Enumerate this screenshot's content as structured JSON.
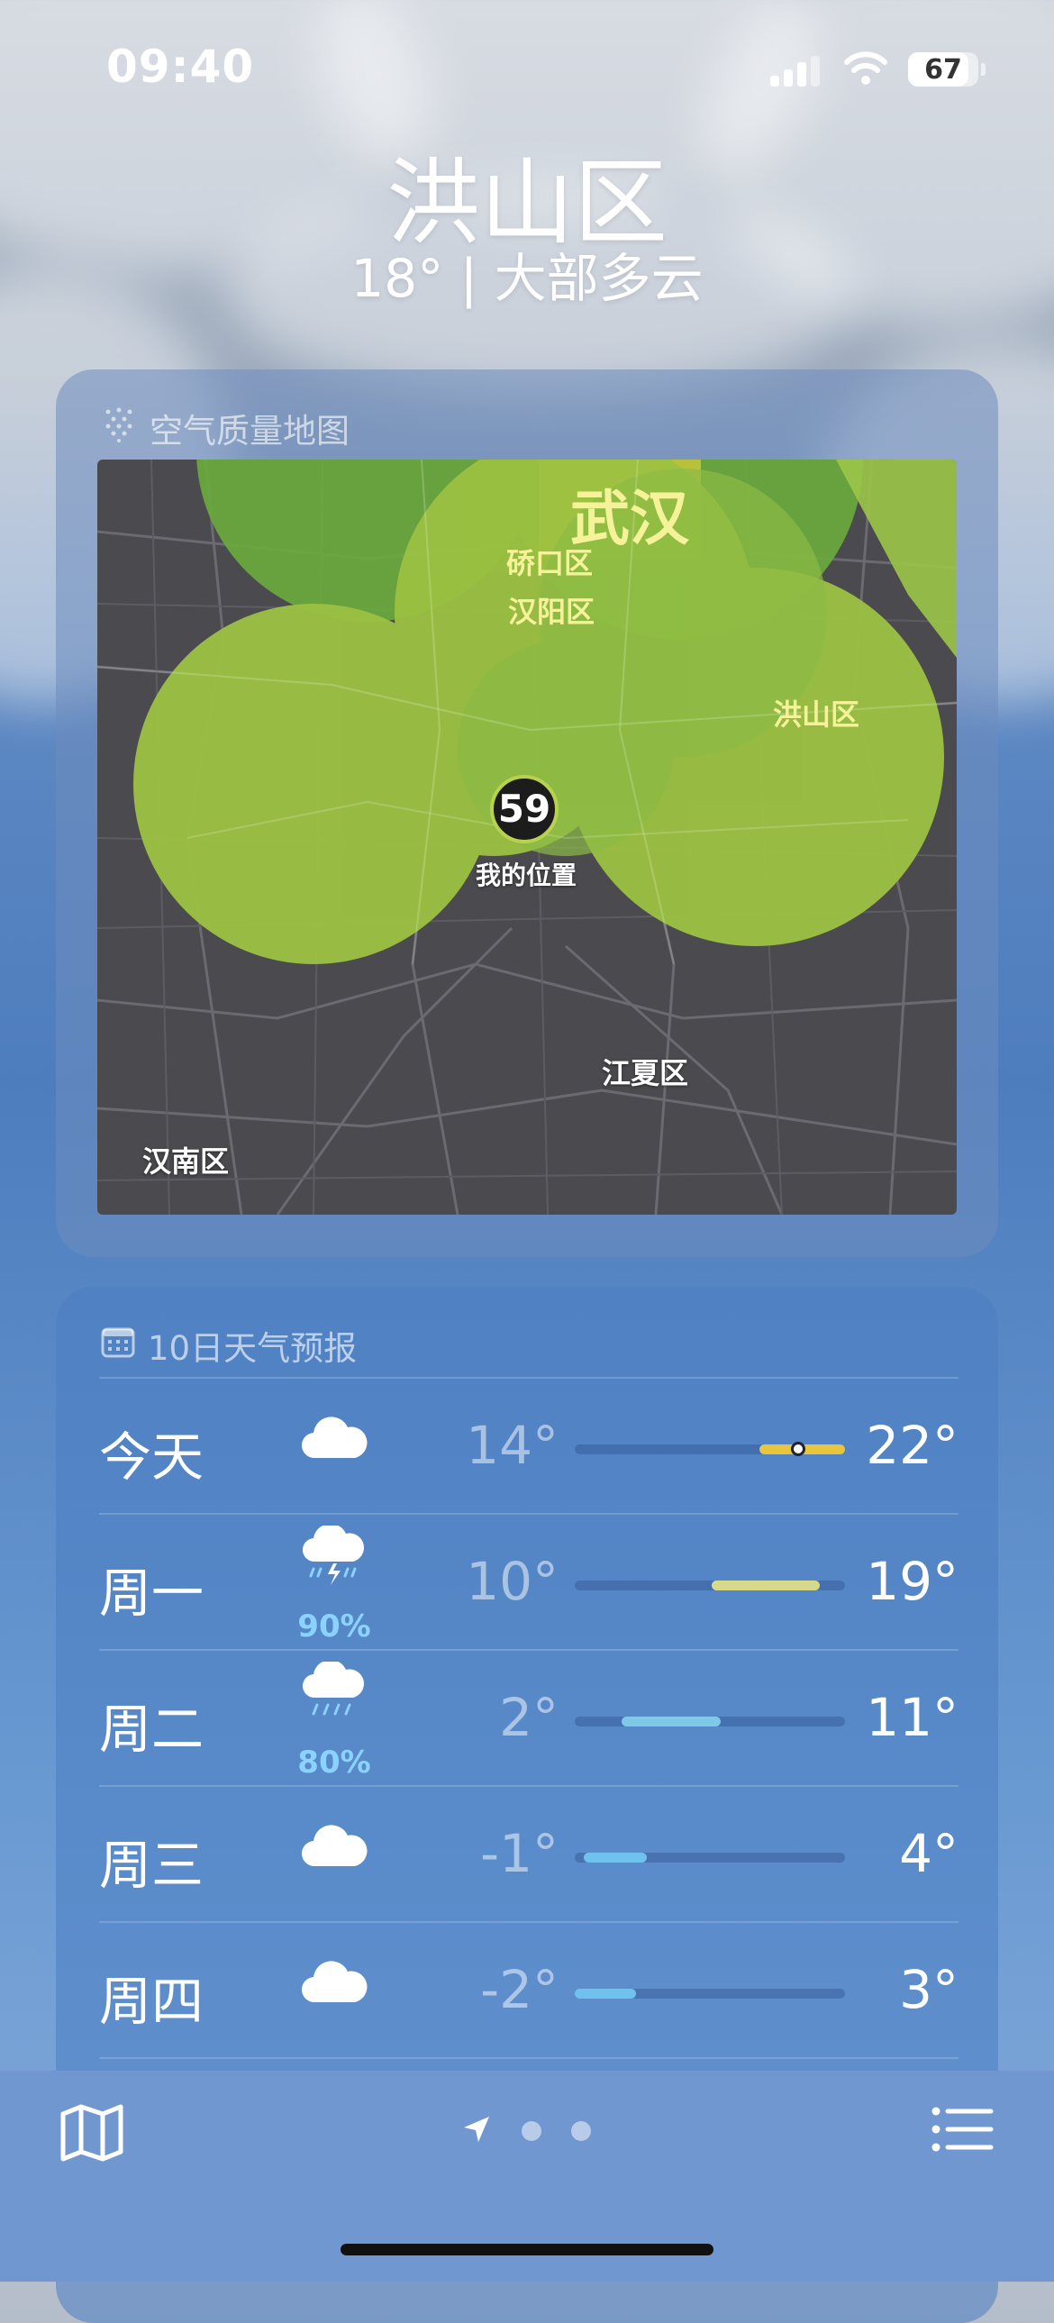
{
  "status_bar": {
    "time": "09:40",
    "battery": "67"
  },
  "header": {
    "city": "洪山区",
    "subtitle": "18° | 大部多云"
  },
  "air_quality": {
    "title": "空气质量地图",
    "aqi": "59",
    "my_location": "我的位置",
    "map_labels": {
      "wuhan": "武汉",
      "qiaokou": "硚口区",
      "hanyang": "汉阳区",
      "hongshan": "洪山区",
      "jiangxia": "江夏区",
      "hannan": "汉南区"
    }
  },
  "forecast": {
    "title": "10日天气预报",
    "days": [
      {
        "day": "今天",
        "icon": "cloud-icon",
        "precip": "",
        "low": "14°",
        "high": "22°",
        "bar_color": "#e8c53a"
      },
      {
        "day": "周一",
        "icon": "thunderstorm-icon",
        "precip": "90%",
        "low": "10°",
        "high": "19°",
        "bar_color": "#d6d98a"
      },
      {
        "day": "周二",
        "icon": "rain-icon",
        "precip": "80%",
        "low": "2°",
        "high": "11°",
        "bar_color": "#7ec9e6"
      },
      {
        "day": "周三",
        "icon": "cloud-icon",
        "precip": "",
        "low": "-1°",
        "high": "4°",
        "bar_color": "#6fc2ee"
      },
      {
        "day": "周四",
        "icon": "cloud-icon",
        "precip": "",
        "low": "-2°",
        "high": "3°",
        "bar_color": "#6fc2ee"
      }
    ]
  },
  "bottom_bar": {
    "icons": [
      "map-icon",
      "location-arrow-icon",
      "list-icon"
    ]
  }
}
